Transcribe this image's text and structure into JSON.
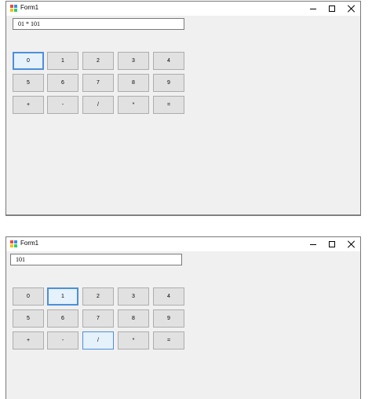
{
  "windows": [
    {
      "title": "Form1",
      "display_value": "01 * 101",
      "keys": [
        "0",
        "1",
        "2",
        "3",
        "4",
        "5",
        "6",
        "7",
        "8",
        "9",
        "+",
        "-",
        "/",
        "*",
        "="
      ]
    },
    {
      "title": "Form1",
      "display_value": "101",
      "keys": [
        "0",
        "1",
        "2",
        "3",
        "4",
        "5",
        "6",
        "7",
        "8",
        "9",
        "+",
        "-",
        "/",
        "*",
        "="
      ]
    }
  ],
  "controls": {
    "minimize": "—",
    "maximize": "☐",
    "close": "✕"
  },
  "icons": {
    "app": "winforms-app-icon",
    "minimize": "minimize-icon",
    "maximize": "maximize-icon",
    "close": "close-icon"
  },
  "colors": {
    "focus_border": "#4d8fd8",
    "key_face": "#e1e1e1",
    "form_bg": "#f0f0f0"
  }
}
